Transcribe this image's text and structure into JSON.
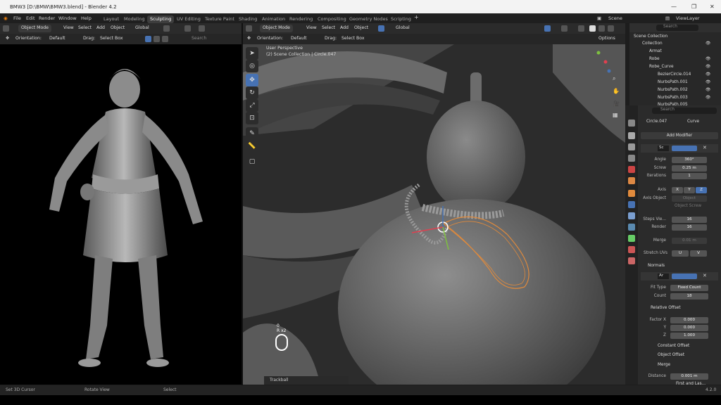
{
  "window": {
    "title": "BMW3 [D:\\BMW\\BMW3.blend] - Blender 4.2"
  },
  "menu": [
    "File",
    "Edit",
    "Render",
    "Window",
    "Help"
  ],
  "workspaces": [
    "Layout",
    "Modeling",
    "Sculpting",
    "UV Editing",
    "Texture Paint",
    "Shading",
    "Animation",
    "Rendering",
    "Compositing",
    "Geometry Nodes",
    "Scripting"
  ],
  "topright": {
    "scene": "Scene",
    "viewlayer": "ViewLayer"
  },
  "left_header": {
    "mode": "Object Mode",
    "view": "View",
    "select": "Select",
    "add": "Add",
    "object": "Object",
    "transform": "Global",
    "orientation": "Orientation:",
    "orientation_val": "Default",
    "drag": "Drag:",
    "drag_val": "Select Box",
    "search": "Search"
  },
  "right_header": {
    "mode": "Object Mode",
    "view": "View",
    "select": "Select",
    "add": "Add",
    "object": "Object",
    "transform": "Global",
    "orientation": "Orientation:",
    "orientation_val": "Default",
    "drag": "Drag:",
    "drag_val": "Select Box",
    "options": "Options"
  },
  "viewport": {
    "perspective": "User Perspective",
    "collection": "(2) Scene Collection | Circle.047",
    "hud_top": "0",
    "hud_bottom": "R x2",
    "trackball": "Trackball"
  },
  "outliner": {
    "search": "Search",
    "root": "Scene Collection",
    "items": [
      {
        "label": "Collection"
      },
      {
        "label": "Armat"
      },
      {
        "label": "Robe"
      },
      {
        "label": "Robe_Curve"
      },
      {
        "label": "BezierCircle.014"
      },
      {
        "label": "NurbsPath.001"
      },
      {
        "label": "NurbsPath.002"
      },
      {
        "label": "NurbsPath.003"
      },
      {
        "label": "NurbsPath.005"
      }
    ]
  },
  "properties": {
    "search": "Search",
    "object": "Circle.047",
    "datatype": "Curve",
    "add_modifier": "Add Modifier",
    "screw": {
      "name": "Sc",
      "angle_label": "Angle",
      "angle": "360°",
      "screw_label": "Screw",
      "screw": "0.25 m",
      "iterations_label": "Iterations",
      "iterations": "1",
      "axis_label": "Axis",
      "axis": [
        "X",
        "Y",
        "Z"
      ],
      "axis_object_label": "Axis Object",
      "axis_object": "Object",
      "object_screw": "Object Screw",
      "steps_viewport_label": "Steps Vie...",
      "steps_viewport": "16",
      "render_label": "Render",
      "render": "16",
      "merge_label": "Merge",
      "merge": "0.01 m",
      "stretch_label": "Stretch UVs",
      "stretch": [
        "U",
        "V"
      ],
      "normals": "Normals"
    },
    "array": {
      "name": "Ar",
      "fit_type_label": "Fit Type",
      "fit_type": "Fixed Count",
      "count_label": "Count",
      "count": "18",
      "relative_offset": "Relative Offset",
      "factor_x_label": "Factor X",
      "factor_x": "0.000",
      "y_label": "Y",
      "y": "0.000",
      "z_label": "Z",
      "z": "1.000",
      "constant_offset": "Constant Offset",
      "object_offset": "Object Offset",
      "merge": "Merge",
      "distance_label": "Distance",
      "distance": "0.001 m",
      "first_last": "First and Las..."
    }
  },
  "status": {
    "left": "Set 3D Cursor",
    "mid": "Rotate View",
    "right": "Select",
    "version": "4.2.0"
  },
  "colors": {
    "accent": "#4772b3",
    "active_ws": "#3d3d3d",
    "wire": "#e08a3c"
  }
}
